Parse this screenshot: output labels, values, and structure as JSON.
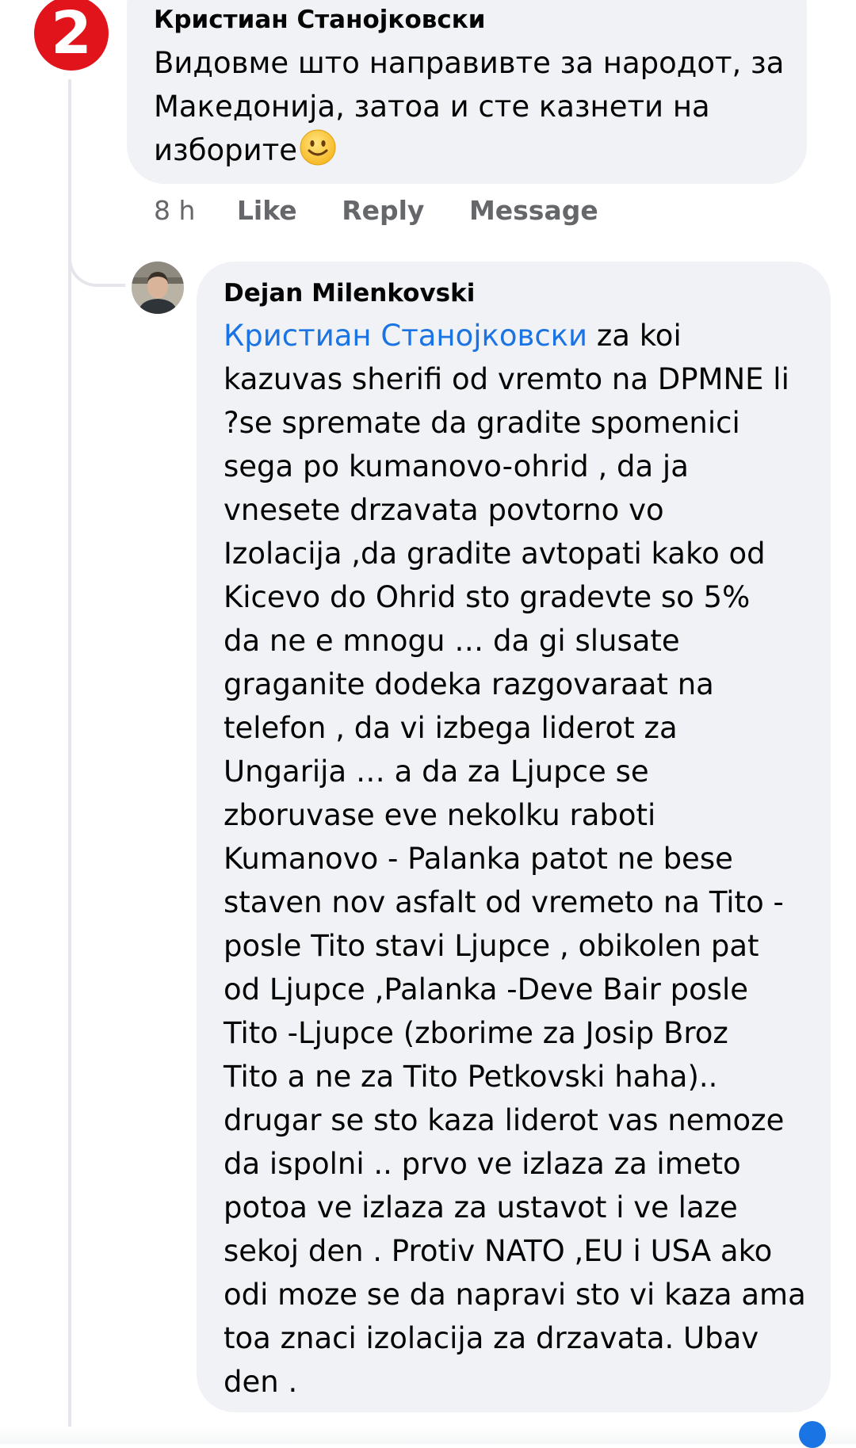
{
  "badge": {
    "number": "2"
  },
  "comment": {
    "author": "Кристиан Станојковски",
    "lines": [
      "Видовме што направивте за народот, за",
      "Македонија, затоа и сте казнети на",
      "изборите"
    ],
    "emoji": "slightly-smiling-face-icon",
    "actions": {
      "time": "8 h",
      "like": "Like",
      "reply": "Reply",
      "message": "Message"
    }
  },
  "reply": {
    "author": "Dejan Milenkovski",
    "mention": "Кристиан Станојковски",
    "first_line_rest": " za koi",
    "lines": [
      "kazuvas sherifi od vremto na DPMNE li",
      "?se spremate da gradite spomenici",
      "sega po kumanovo-ohrid , da ja",
      "vnesete drzavata povtorno vo",
      "Izolacija ,da gradite avtopati kako od",
      "Kicevo do Ohrid sto gradevte so 5%",
      "da ne e mnogu … da gi slusate",
      "graganite dodeka razgovaraat na",
      "telefon , da vi izbega liderot za",
      "Ungarija … a da za Ljupce se",
      "zboruvase eve nekolku raboti",
      "Kumanovo - Palanka patot ne bese",
      "staven nov asfalt od vremeto na Tito -",
      "posle Tito stavi Ljupce , obikolen pat",
      "od Ljupce ,Palanka -Deve Bair posle",
      "Tito -Ljupce (zborime za Josip Broz",
      "Tito a ne za Tito Petkovski haha)..",
      "drugar se sto kaza liderot vas nemoze",
      "da ispolni .. prvo ve izlaza za imeto",
      "potoa ve izlaza za ustavot i ve laze",
      "sekoj den . Protiv NATO ,EU i USA ako",
      "odi moze se da napravi sto vi kaza ama",
      "toa znaci izolacija za drzavata. Ubav",
      "den ."
    ]
  },
  "colors": {
    "bubble": "#f0f2f5",
    "mention": "#1b74e4",
    "meta": "#65676b",
    "badge": "#e1141b"
  }
}
